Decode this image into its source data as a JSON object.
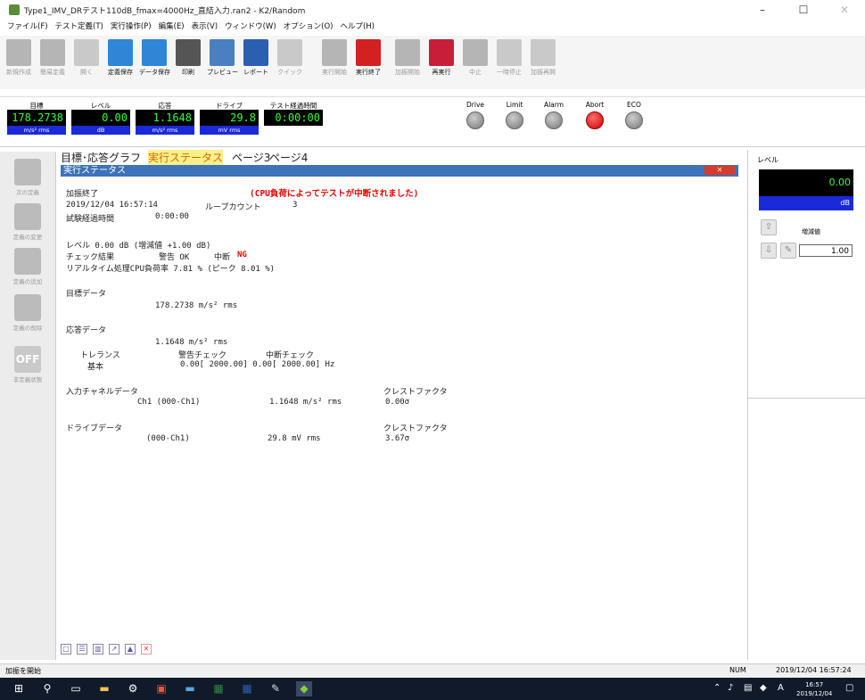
{
  "window": {
    "title": "Type1_IMV_DRテスト110dB_fmax=4000Hz_直結入力.ran2 - K2/Random",
    "minimize_glyph": "–",
    "maximize_glyph": "☐",
    "close_glyph": "✕"
  },
  "menu": [
    "ファイル(F)",
    "テスト定義(T)",
    "実行操作(P)",
    "編集(E)",
    "表示(V)",
    "ウィンドウ(W)",
    "オプション(O)",
    "ヘルプ(H)"
  ],
  "toolbar": [
    {
      "label": "新規作成",
      "icon": "new-doc-icon",
      "enabled": false,
      "color": "#b5b5b5"
    },
    {
      "label": "簡易定義",
      "icon": "quick-define-icon",
      "enabled": false,
      "color": "#b5b5b5"
    },
    {
      "label": "開く",
      "icon": "open-folder-icon",
      "enabled": false,
      "color": "#c9c9c9"
    },
    {
      "label": "定義保存",
      "icon": "save-definition-icon",
      "enabled": true,
      "color": "#2f86d6"
    },
    {
      "label": "データ保存",
      "icon": "save-data-icon",
      "enabled": true,
      "color": "#2f86d6"
    },
    {
      "label": "印刷",
      "icon": "printer-icon",
      "enabled": true,
      "color": "#555555"
    },
    {
      "label": "プレビュー",
      "icon": "print-preview-icon",
      "enabled": true,
      "color": "#4a7fc1"
    },
    {
      "label": "レポート",
      "icon": "word-report-icon",
      "enabled": true,
      "color": "#2b5fb0"
    },
    {
      "label": "クイック",
      "icon": "quick-report-icon",
      "enabled": false,
      "color": "#c9c9c9"
    },
    {
      "label": "実行開始",
      "icon": "run-start-icon",
      "enabled": false,
      "color": "#b5b5b5"
    },
    {
      "label": "実行終了",
      "icon": "run-stop-icon",
      "enabled": true,
      "color": "#d32020"
    },
    {
      "label": "加振開始",
      "icon": "play-icon",
      "enabled": false,
      "color": "#b5b5b5"
    },
    {
      "label": "再実行",
      "icon": "rerun-icon",
      "enabled": true,
      "color": "#c81e3a"
    },
    {
      "label": "中止",
      "icon": "stop-square-icon",
      "enabled": false,
      "color": "#b5b5b5"
    },
    {
      "label": "一時停止",
      "icon": "pause-icon",
      "enabled": false,
      "color": "#c9c9c9"
    },
    {
      "label": "加振再開",
      "icon": "resume-icon",
      "enabled": false,
      "color": "#c9c9c9"
    }
  ],
  "monitors": [
    {
      "header": "目標",
      "value": "178.2738",
      "unit": "m/s² rms"
    },
    {
      "header": "レベル",
      "value": "0.00",
      "unit": "dB"
    },
    {
      "header": "応答",
      "value": "1.1648",
      "unit": "m/s² rms"
    },
    {
      "header": "ドライブ",
      "value": "29.8",
      "unit": "mV rms"
    },
    {
      "header": "テスト経過時間",
      "value": "0:00:00",
      "unit": ""
    }
  ],
  "lamps": [
    {
      "label": "Drive",
      "state": "off"
    },
    {
      "label": "Limit",
      "state": "off"
    },
    {
      "label": "Alarm",
      "state": "off"
    },
    {
      "label": "Abort",
      "state": "on"
    },
    {
      "label": "ECO",
      "state": "off"
    }
  ],
  "left_tools": [
    {
      "label": "次の定義",
      "icon": "arrow-down-icon"
    },
    {
      "label": "定義の変更",
      "icon": "pencil-icon"
    },
    {
      "label": "定義の追加",
      "icon": "plus-icon"
    },
    {
      "label": "定義の削除",
      "icon": "delete-x-icon"
    },
    {
      "label": "非定義状態",
      "icon": "off-icon",
      "badge": "OFF"
    }
  ],
  "tabs": [
    {
      "label": "目標･応答グラフ",
      "active": false
    },
    {
      "label": "実行ステータス",
      "active": true
    },
    {
      "label": "ページ3",
      "active": false
    },
    {
      "label": "ページ4",
      "active": false
    }
  ],
  "panel": {
    "title": "実行ステータス",
    "close_glyph": "✕"
  },
  "status": {
    "state": "加振終了",
    "abort_message": "(CPU負荷によってテストが中断されました)",
    "datetime": "2019/12/04 16:57:14",
    "loop_label": "ループカウント",
    "loop_value": "3",
    "elapsed_label": "試験経過時間",
    "elapsed_value": "0:00:00",
    "level_line": "レベル  0.00 dB (増減値 +1.00 dB)",
    "check_label": "チェック結果",
    "warn_label": "警告 OK",
    "abort_label": "中断",
    "abort_value": "NG",
    "cpu_line": "リアルタイム処理CPU負荷率  7.81 % (ピーク 8.01 %)",
    "target_header": "目標データ",
    "target_value": "178.2738 m/s² rms",
    "response_header": "応答データ",
    "response_value": "1.1648 m/s² rms",
    "tol_header_1": "トレランス",
    "tol_header_2": "警告チェック",
    "tol_header_3": "中断チェック",
    "tol_row_label": "基本",
    "tol_row_values": "0.00[  2000.00]  0.00[  2000.00] Hz",
    "input_header": "入力チャネルデータ",
    "crest_header": "クレストファクタ",
    "input_channel": "Ch1 (000-Ch1)",
    "input_value": "1.1648 m/s² rms",
    "input_crest": "0.00σ",
    "drive_header": "ドライブデータ",
    "drive_crest_header": "クレストファクタ",
    "drive_channel": "(000-Ch1)",
    "drive_value": "29.8 mV rms",
    "drive_crest": "3.67σ"
  },
  "right_panel": {
    "label": "レベル",
    "value": "0.00",
    "unit": "dB",
    "increment_label": "増減値",
    "increment_value": "1.00",
    "up_glyph": "⇧",
    "down_glyph": "⇩",
    "edit_glyph": "✎"
  },
  "statusbar": {
    "left": "加振を開始",
    "num": "NUM",
    "datetime": "2019/12/04  16:57:24"
  },
  "taskbar": {
    "time": "16:57",
    "date": "2019/12/04",
    "ime": "A"
  }
}
